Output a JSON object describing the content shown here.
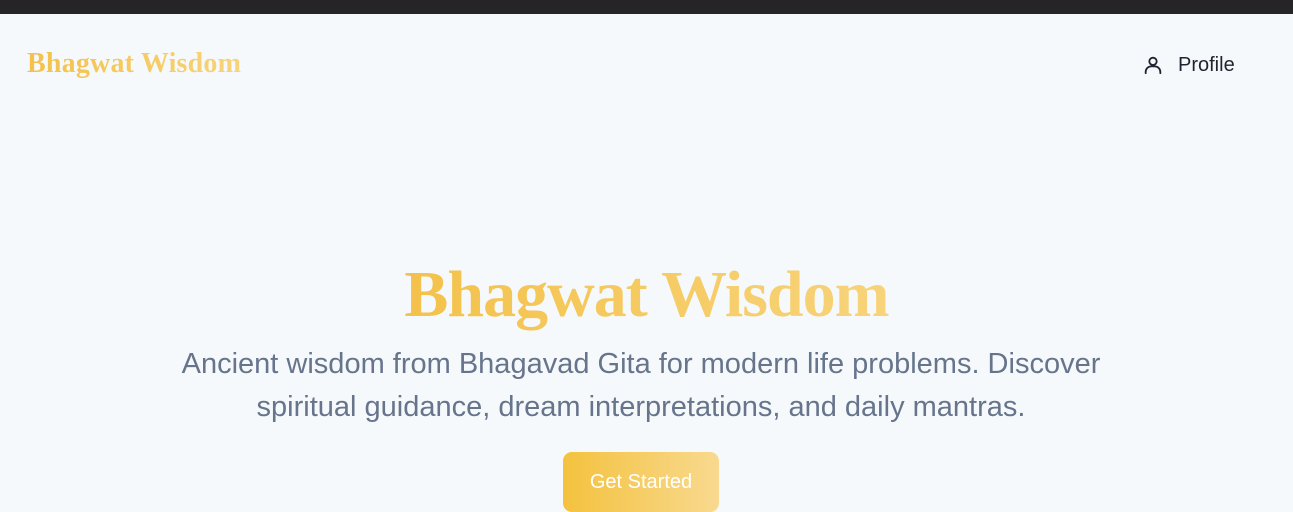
{
  "app": {
    "brand": "Bhagwat Wisdom"
  },
  "nav": {
    "profile_label": "Profile",
    "profile_icon": "user-icon"
  },
  "hero": {
    "title": "Bhagwat Wisdom",
    "subtitle": "Ancient wisdom from Bhagavad Gita for modern life problems. Discover spiritual guidance, dream interpretations, and daily mantras.",
    "cta_label": "Get Started"
  },
  "colors": {
    "accent_start": "#f4c24b",
    "accent_end": "#f7d37a",
    "background": "#f6f9fb",
    "subtitle_text": "#66748c",
    "top_strip": "#252528"
  }
}
